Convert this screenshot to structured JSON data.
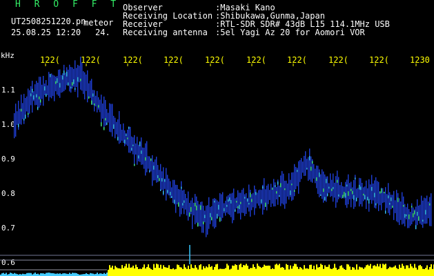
{
  "app_title": "H R O F F T",
  "file_name": "UT2508251220.pn",
  "file_suffix": "meteor",
  "date_time": "25.08.25 12:20",
  "frame_count": "24.",
  "info": [
    {
      "label": "Observer",
      "value": ":Masaki Kano"
    },
    {
      "label": "Receiving Location",
      "value": ":Shibukawa,Gunma,Japan"
    },
    {
      "label": "Receiver",
      "value": ":RTL-SDR SDR# 43dB L15 114.1MHz USB"
    },
    {
      "label": "Receiving antenna",
      "value": ":5el Yagi Az 20 for Aomori VOR"
    }
  ],
  "freq_unit": "kHz",
  "time_ticks": [
    "122(",
    "122(",
    "122(",
    "122(",
    "122(",
    "122(",
    "122(",
    "122(",
    "122(",
    "1230"
  ],
  "freq_ticks": [
    "1.1",
    "1.0",
    "0.9",
    "0.8",
    "0.7",
    "0.6"
  ],
  "colors": {
    "background": "#000000",
    "text": "#ffffff",
    "accent": "#ffff00",
    "title": "#33ee66",
    "trace_blue": "#1f3fd8",
    "trace_cyan": "#38c8ff",
    "trace_green": "#44ee88",
    "level_bar": "#ffff00"
  },
  "chart_data": {
    "type": "heatmap",
    "title": "",
    "xlabel": "",
    "ylabel": "kHz",
    "x_ticks": [
      "122(",
      "122(",
      "122(",
      "122(",
      "122(",
      "122(",
      "122(",
      "122(",
      "122(",
      "1230"
    ],
    "ylim": [
      0.6,
      1.18
    ],
    "trace": [
      {
        "t": 0,
        "f": 1.0
      },
      {
        "t": 0.04,
        "f": 1.08
      },
      {
        "t": 0.08,
        "f": 1.1
      },
      {
        "t": 0.12,
        "f": 1.13
      },
      {
        "t": 0.16,
        "f": 1.14
      },
      {
        "t": 0.2,
        "f": 1.06
      },
      {
        "t": 0.26,
        "f": 0.97
      },
      {
        "t": 0.3,
        "f": 0.92
      },
      {
        "t": 0.34,
        "f": 0.86
      },
      {
        "t": 0.38,
        "f": 0.8
      },
      {
        "t": 0.42,
        "f": 0.76
      },
      {
        "t": 0.46,
        "f": 0.73
      },
      {
        "t": 0.5,
        "f": 0.76
      },
      {
        "t": 0.54,
        "f": 0.77
      },
      {
        "t": 0.6,
        "f": 0.79
      },
      {
        "t": 0.66,
        "f": 0.81
      },
      {
        "t": 0.7,
        "f": 0.89
      },
      {
        "t": 0.74,
        "f": 0.82
      },
      {
        "t": 0.8,
        "f": 0.8
      },
      {
        "t": 0.86,
        "f": 0.8
      },
      {
        "t": 0.9,
        "f": 0.78
      },
      {
        "t": 0.95,
        "f": 0.73
      },
      {
        "t": 1.0,
        "f": 0.75
      }
    ]
  }
}
